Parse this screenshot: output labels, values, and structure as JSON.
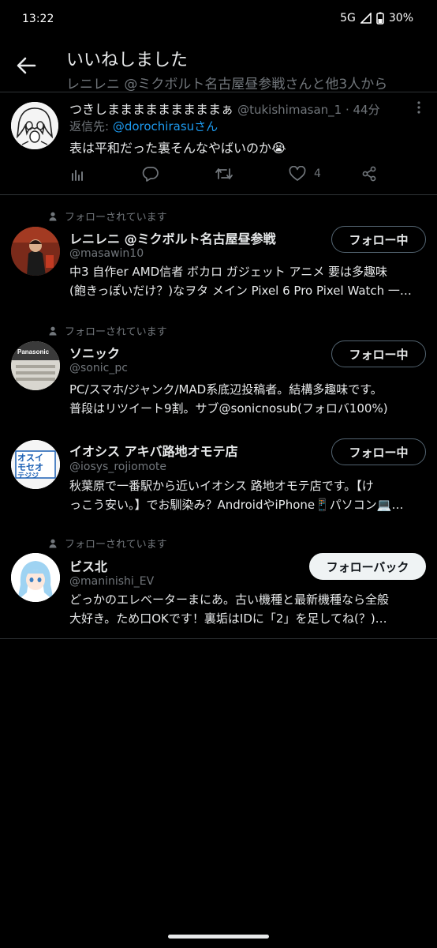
{
  "status_bar": {
    "time": "13:22",
    "network": "5G",
    "battery": "30%"
  },
  "header": {
    "title": "いいねしました",
    "subtitle": "レニレニ @ミクボルト名古屋昼参戦さんと他3人から"
  },
  "tweet": {
    "name": "つきしまままままままままぁ",
    "handle": "@tukishimasan_1 · 44分",
    "reply_prefix": "返信先: ",
    "reply_user": "@dorochirasu",
    "reply_suffix": "さん",
    "text": "表は平和だった裏そんなやばいのか😭",
    "like_count": "4",
    "icons": [
      "analytics-icon",
      "reply-icon",
      "retweet-icon",
      "heart-icon",
      "share-icon",
      "more-icon"
    ]
  },
  "follows_you_label": "フォローされています",
  "users": [
    {
      "show_follows_you": true,
      "name": "レニレニ @ミクボルト名古屋昼参戦",
      "handle": "@masawin10",
      "bio_line1": "中3 自作er AMD信者 ボカロ ガジェット アニメ 要は多趣味",
      "bio_line2": "(飽きっぽいだけ？)なヲタ メイン Pixel 6 Pro Pixel Watch 一…",
      "button": "フォロー中"
    },
    {
      "show_follows_you": true,
      "name": "ソニック",
      "handle": "@sonic_pc",
      "bio_line1": "PC/スマホ/ジャンク/MAD系底辺投稿者。結構多趣味です。",
      "bio_line2": "普段はリツイート9割。サブ@sonicnosub(フォロバ100%)",
      "button": "フォロー中",
      "avatar_text": "Panasonic"
    },
    {
      "show_follows_you": false,
      "name": "イオシス アキバ路地オモテ店",
      "handle": "@iosys_rojiomote",
      "bio_line1": "秋葉原で一番駅から近いイオシス 路地オモテ店です。【け",
      "bio_line2": "っこう安い。】でお馴染み？AndroidやiPhone📱パソコン💻…",
      "button": "フォロー中",
      "avatar_text": "オスイモセオテジジ"
    },
    {
      "show_follows_you": true,
      "name": "ビス北",
      "handle": "@maninishi_EV",
      "bio_line1": "どっかのエレベーターまにあ。古い機種と最新機種なら全般",
      "bio_line2": "大好き。ため口OKです！裏垢はIDに「2」を足してね(？)…",
      "button": "フォローバック"
    }
  ]
}
